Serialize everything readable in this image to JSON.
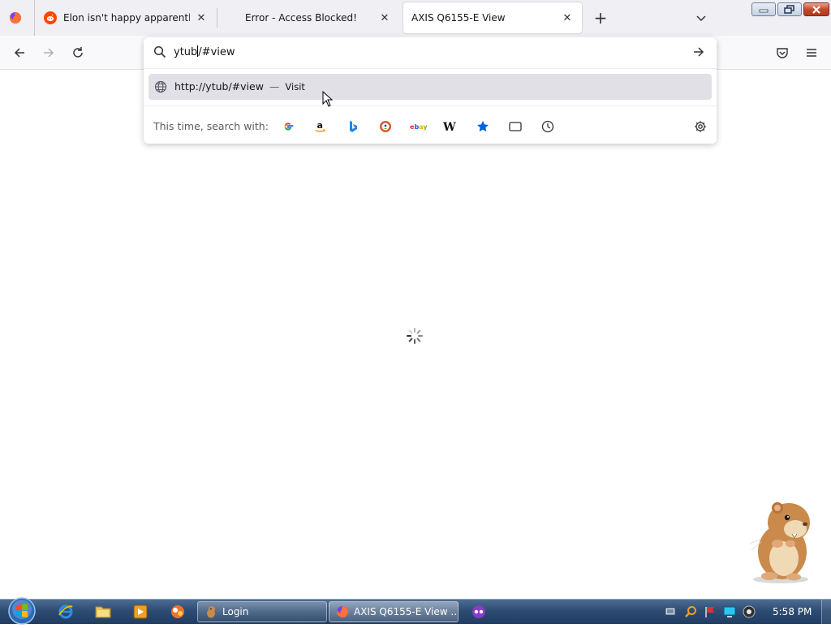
{
  "browser": {
    "tabs": [
      {
        "label": "Elon isn't happy apparently : Wh",
        "favicon": "reddit-icon",
        "active": false
      },
      {
        "label": "Error - Access Blocked!",
        "favicon": "none",
        "active": false
      },
      {
        "label": "AXIS Q6155-E View",
        "favicon": "none",
        "active": true
      }
    ],
    "new_tab_symbol": "+",
    "tab_list_symbol": "⌄"
  },
  "urlbar": {
    "value_before_caret": "ytub",
    "value_after_caret": "/#view",
    "suggestion": {
      "url": "http://ytub/#view",
      "dash": "—",
      "action": "Visit"
    },
    "search_with_label": "This time, search with:",
    "engines": [
      "Google",
      "Amazon",
      "Bing",
      "DuckDuckGo",
      "eBay",
      "Wikipedia",
      "Bookmarks",
      "Tabs",
      "History"
    ]
  },
  "taskbar": {
    "tasks": [
      {
        "label": "Login",
        "icon": "hamster-icon"
      },
      {
        "label": "AXIS Q6155-E View ...",
        "icon": "firefox-icon"
      }
    ],
    "clock": "5:58 PM"
  },
  "colors": {
    "accent": "#0061e0",
    "reddit": "#ff4500",
    "firefox": "#ff7139"
  }
}
